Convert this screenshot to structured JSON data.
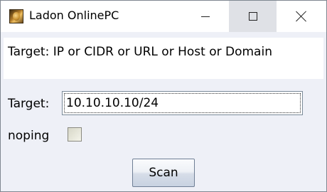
{
  "window": {
    "title": "Ladon OnlinePC",
    "icon": "ladon-app-icon"
  },
  "titlebar_buttons": {
    "minimize": "minimize-icon",
    "maximize": "maximize-icon",
    "close": "close-icon"
  },
  "info": {
    "text": "Target: IP or CIDR or URL or Host or Domain"
  },
  "form": {
    "target_label": "Target:",
    "target_value": "10.10.10.10/24",
    "noping_label": "noping",
    "noping_checked": false
  },
  "actions": {
    "scan_label": "Scan"
  }
}
